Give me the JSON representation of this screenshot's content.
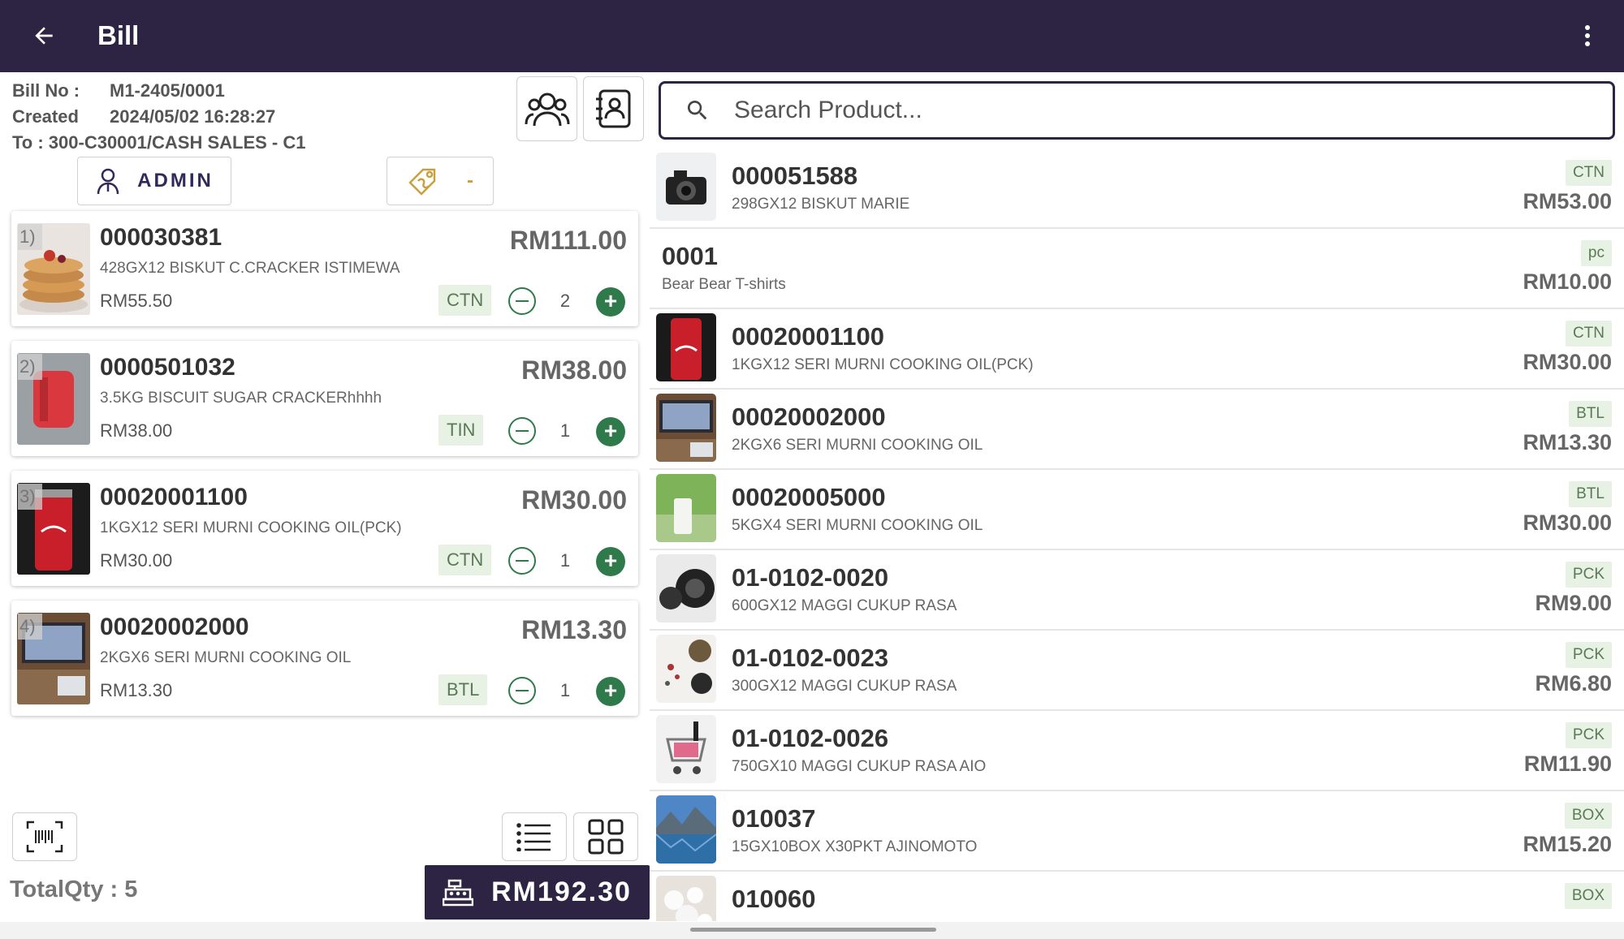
{
  "header": {
    "title": "Bill"
  },
  "bill": {
    "no_label": "Bill No :",
    "no_value": "M1-2405/0001",
    "created_label": "Created",
    "created_value": "2024/05/02 16:28:27",
    "to_text": "To : 300-C30001/CASH SALES - C1",
    "salesperson": "ADMIN",
    "discount": "-"
  },
  "cart": [
    {
      "index": "1)",
      "code": "000030381",
      "name": "428GX12 BISKUT C.CRACKER ISTIMEWA",
      "unit_price": "RM55.50",
      "total": "RM111.00",
      "uom": "CTN",
      "qty": "2"
    },
    {
      "index": "2)",
      "code": "0000501032",
      "name": "3.5KG BISCUIT SUGAR CRACKERhhhh",
      "unit_price": "RM38.00",
      "total": "RM38.00",
      "uom": "TIN",
      "qty": "1"
    },
    {
      "index": "3)",
      "code": "00020001100",
      "name": "1KGX12  SERI MURNI COOKING OIL(PCK)",
      "unit_price": "RM30.00",
      "total": "RM30.00",
      "uom": "CTN",
      "qty": "1"
    },
    {
      "index": "4)",
      "code": "00020002000",
      "name": "2KGX6 SERI MURNI COOKING OIL",
      "unit_price": "RM13.30",
      "total": "RM13.30",
      "uom": "BTL",
      "qty": "1"
    }
  ],
  "footer": {
    "total_qty": "TotalQty : 5",
    "grand_total": "RM192.30"
  },
  "search": {
    "placeholder": "Search Product..."
  },
  "products": [
    {
      "code": "000051588",
      "name": "298GX12 BISKUT MARIE",
      "uom": "CTN",
      "price": "RM53.00",
      "image": "camera"
    },
    {
      "code": "0001",
      "name": "Bear Bear T-shirts",
      "uom": "pc",
      "price": "RM10.00",
      "image": ""
    },
    {
      "code": "00020001100",
      "name": "1KGX12  SERI MURNI COOKING OIL(PCK)",
      "uom": "CTN",
      "price": "RM30.00",
      "image": "can"
    },
    {
      "code": "00020002000",
      "name": "2KGX6 SERI MURNI COOKING OIL",
      "uom": "BTL",
      "price": "RM13.30",
      "image": "laptop"
    },
    {
      "code": "00020005000",
      "name": "5KGX4 SERI MURNI COOKING OIL",
      "uom": "BTL",
      "price": "RM30.00",
      "image": "milk"
    },
    {
      "code": "01-0102-0020",
      "name": "600GX12 MAGGI CUKUP RASA",
      "uom": "PCK",
      "price": "RM9.00",
      "image": "lens"
    },
    {
      "code": "01-0102-0023",
      "name": "300GX12 MAGGI CUKUP RASA",
      "uom": "PCK",
      "price": "RM6.80",
      "image": "spices"
    },
    {
      "code": "01-0102-0026",
      "name": "750GX10 MAGGI CUKUP RASA AIO",
      "uom": "PCK",
      "price": "RM11.90",
      "image": "cart"
    },
    {
      "code": "010037",
      "name": "15GX10BOX X30PKT AJINOMOTO",
      "uom": "BOX",
      "price": "RM15.20",
      "image": "lake"
    },
    {
      "code": "010060",
      "name": "",
      "uom": "BOX",
      "price": "",
      "image": "flowers"
    }
  ]
}
